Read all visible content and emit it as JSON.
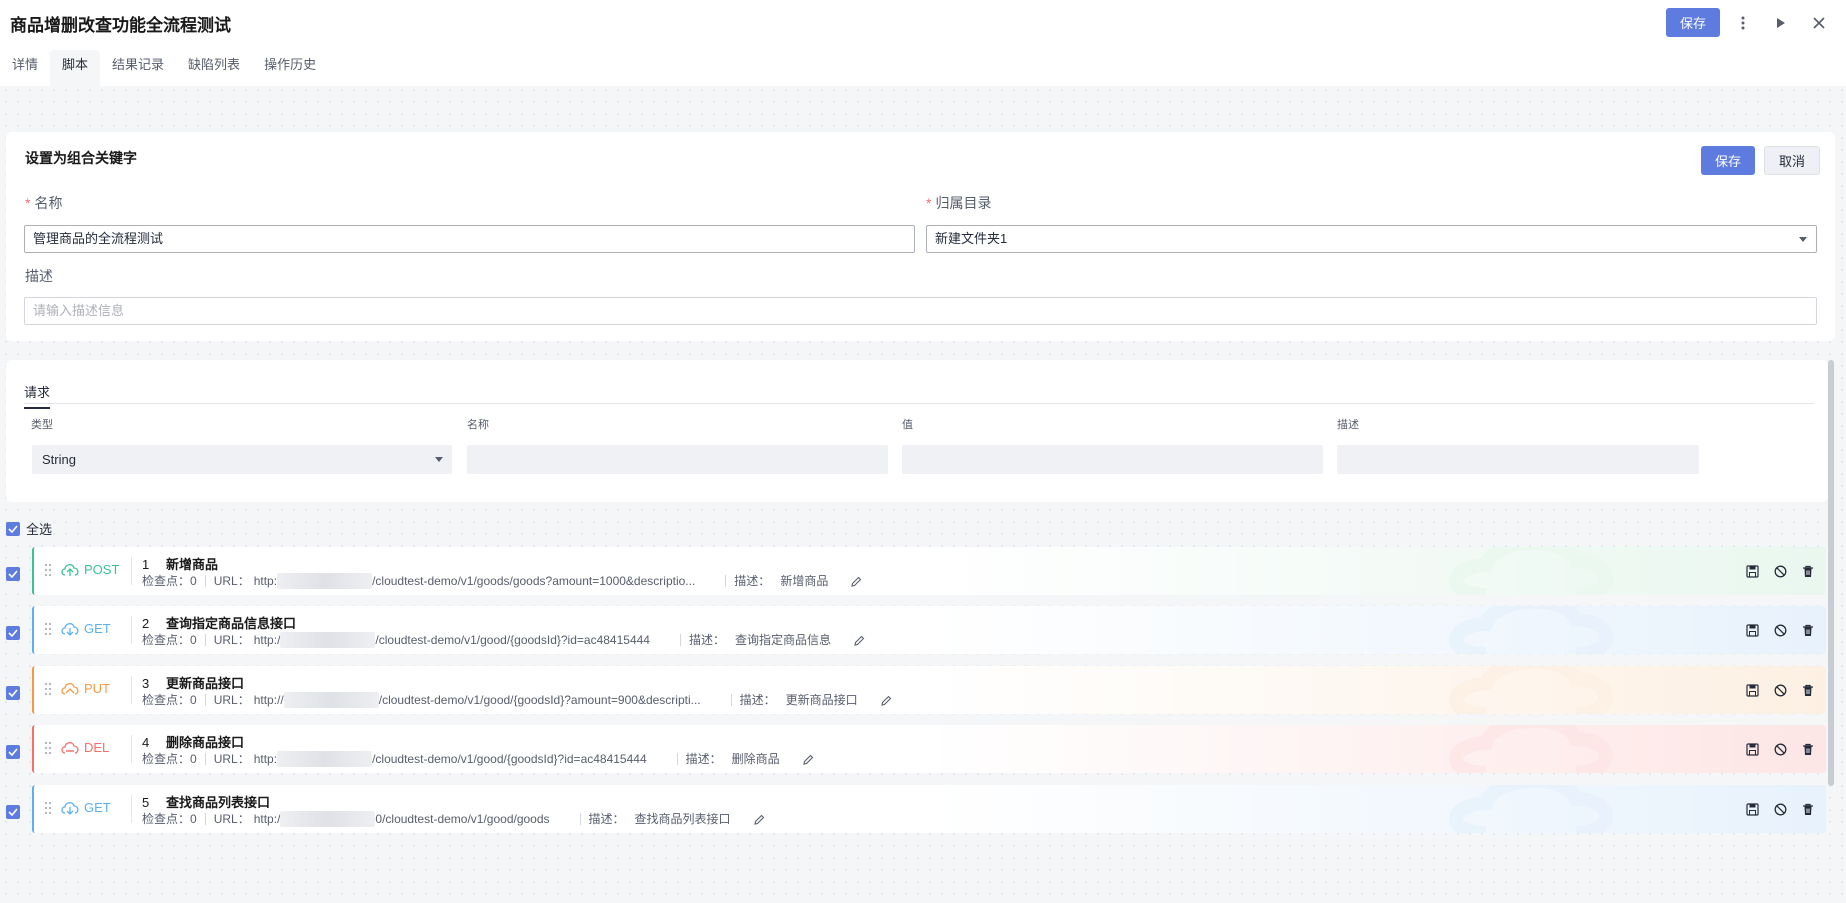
{
  "header": {
    "title": "商品增删改查功能全流程测试",
    "save_label": "保存"
  },
  "tabs": [
    {
      "label": "详情",
      "active": false
    },
    {
      "label": "脚本",
      "active": true
    },
    {
      "label": "结果记录",
      "active": false
    },
    {
      "label": "缺陷列表",
      "active": false
    },
    {
      "label": "操作历史",
      "active": false
    }
  ],
  "keyword_form": {
    "title": "设置为组合关键字",
    "save_label": "保存",
    "cancel_label": "取消",
    "name_label": "名称",
    "name_value": "管理商品的全流程测试",
    "dir_label": "归属目录",
    "dir_value": "新建文件夹1",
    "desc_label": "描述",
    "desc_placeholder": "请输入描述信息"
  },
  "request": {
    "tab_label": "请求",
    "columns": [
      "类型",
      "名称",
      "值",
      "描述"
    ],
    "type_value": "String"
  },
  "select_all_label": "全选",
  "labels": {
    "check_points": "检查点：",
    "url": "URL：",
    "desc": "描述："
  },
  "apis": [
    {
      "index": "1",
      "method": "POST",
      "name": "新增商品",
      "check_count": "0",
      "url_prefix": "http:",
      "url_suffix": "/cloudtest-demo/v1/goods/goods?amount=1000&descriptio...",
      "desc": "新增商品",
      "color": "#3ac295",
      "bg": "#e9f7ef"
    },
    {
      "index": "2",
      "method": "GET",
      "name": "查询指定商品信息接口",
      "check_count": "0",
      "url_prefix": "http:/",
      "url_suffix": "/cloudtest-demo/v1/good/{goodsId}?id=ac48415444",
      "desc": "查询指定商品信息",
      "color": "#5cb0f0",
      "bg": "#e8f2fc"
    },
    {
      "index": "3",
      "method": "PUT",
      "name": "更新商品接口",
      "check_count": "0",
      "url_prefix": "http://",
      "url_suffix": "/cloudtest-demo/v1/good/{goodsId}?amount=900&descripti...",
      "desc": "更新商品接口",
      "color": "#fa9841",
      "bg": "#fdf0e3"
    },
    {
      "index": "4",
      "method": "DEL",
      "name": "删除商品接口",
      "check_count": "0",
      "url_prefix": "http:",
      "url_suffix": "/cloudtest-demo/v1/good/{goodsId}?id=ac48415444",
      "desc": "删除商品",
      "color": "#f66f6a",
      "bg": "#fde6e5"
    },
    {
      "index": "5",
      "method": "GET",
      "name": "查找商品列表接口",
      "check_count": "0",
      "url_prefix": "http:/",
      "url_suffix": "0/cloudtest-demo/v1/good/goods",
      "desc": "查找商品列表接口",
      "color": "#5cb0f0",
      "bg": "#e8f2fc"
    }
  ],
  "icons": {
    "more": "more-vertical-icon",
    "run": "play-icon",
    "close": "close-icon",
    "drag": "drag-handle-icon",
    "save": "save-icon",
    "disable": "disable-icon",
    "delete": "delete-icon",
    "edit": "edit-icon"
  }
}
